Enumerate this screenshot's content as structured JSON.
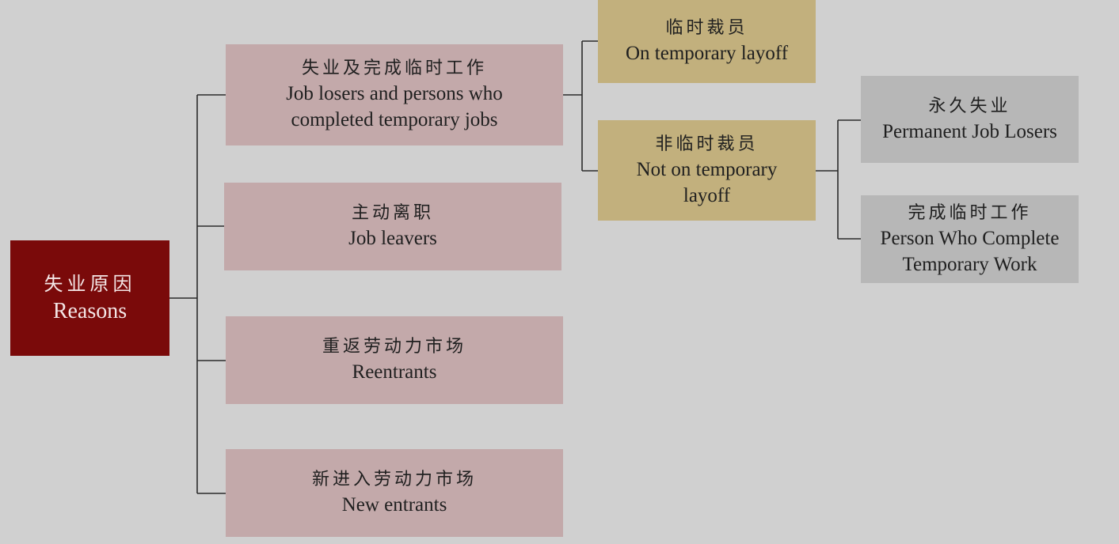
{
  "diagram": {
    "root": {
      "zh": "失业原因",
      "en": "Reasons"
    },
    "categories": [
      {
        "zh": "失业及完成临时工作",
        "en_line1": "Job losers and persons who",
        "en_line2": "completed temporary jobs"
      },
      {
        "zh": "主动离职",
        "en_line1": "Job leavers"
      },
      {
        "zh": "重返劳动力市场",
        "en_line1": "Reentrants"
      },
      {
        "zh": "新进入劳动力市场",
        "en_line1": "New entrants"
      }
    ],
    "job_loser_types": [
      {
        "zh": "临时裁员",
        "en_line1": "On temporary layoff"
      },
      {
        "zh": "非临时裁员",
        "en_line1": "Not on temporary",
        "en_line2": "layoff"
      }
    ],
    "not_on_layoff_types": [
      {
        "zh": "永久失业",
        "en_line1": "Permanent Job Losers"
      },
      {
        "zh": "完成临时工作",
        "en_line1": "Person Who Complete",
        "en_line2": "Temporary Work"
      }
    ]
  },
  "colors": {
    "background": "#d0d0d0",
    "root_fill": "#7a0a0a",
    "category_fill": "#c3a9aa",
    "layoff_fill": "#c2b07d",
    "outcome_fill": "#b7b7b7",
    "connector": "#2a2a2a"
  }
}
